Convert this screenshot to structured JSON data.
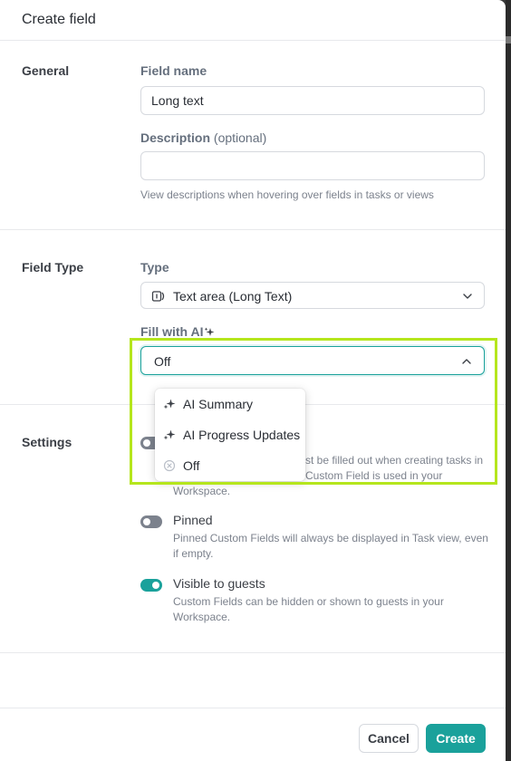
{
  "header": {
    "title": "Create field"
  },
  "general": {
    "section_label": "General",
    "field_name_label": "Field name",
    "field_name_value": "Long text",
    "description_label": "Description",
    "description_optional": "(optional)",
    "description_value": "",
    "description_helper": "View descriptions when hovering over fields in tasks or views"
  },
  "field_type": {
    "section_label": "Field Type",
    "type_label": "Type",
    "type_value": "Text area (Long Text)",
    "type_icon": "text-area-icon",
    "ai_label": "Fill with AI",
    "ai_value": "Off",
    "ai_options": [
      {
        "label": "AI Summary",
        "icon": "sparkle-icon"
      },
      {
        "label": "AI Progress Updates",
        "icon": "sparkle-icon"
      },
      {
        "label": "Off",
        "icon": "circle-x-icon"
      }
    ]
  },
  "settings": {
    "section_label": "Settings",
    "required_desc_line1": "st be filled out when creating tasks in",
    "required_desc_line2": "Custom Field is used in your",
    "required_desc_line3": "Workspace.",
    "pinned_title": "Pinned",
    "pinned_desc": "Pinned Custom Fields will always be displayed in Task view, even if empty.",
    "visible_title": "Visible to guests",
    "visible_desc": "Custom Fields can be hidden or shown to guests in your Workspace."
  },
  "footer": {
    "cancel_label": "Cancel",
    "create_label": "Create"
  },
  "colors": {
    "accent": "#1aa19b",
    "highlight": "#b5e61d",
    "toggle_off": "#7c828d"
  }
}
